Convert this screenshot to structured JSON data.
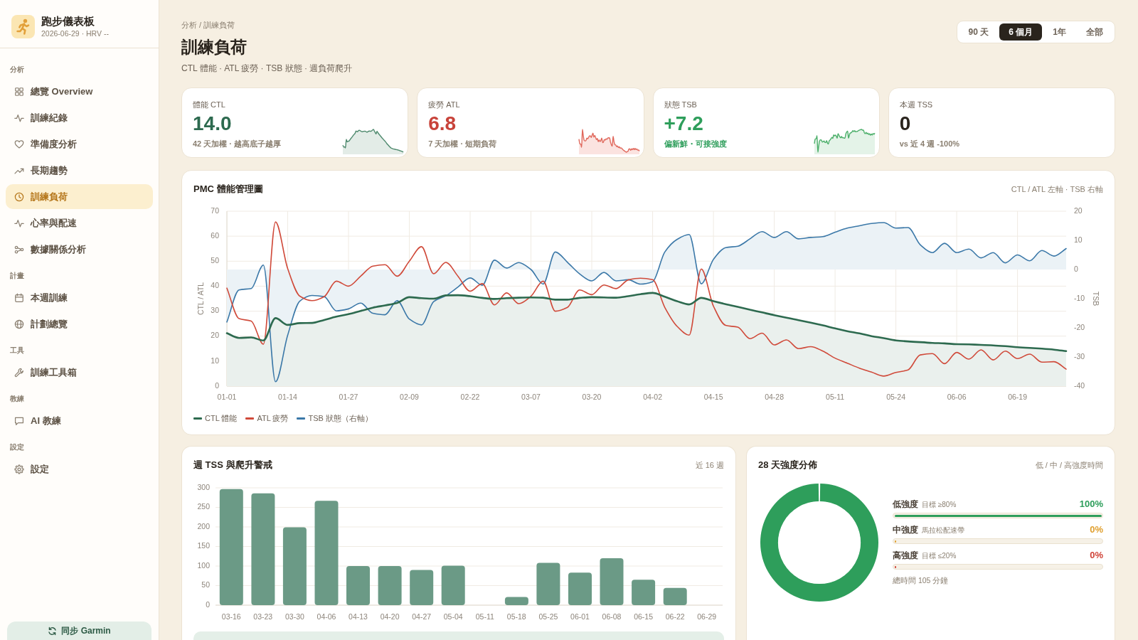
{
  "sidebar": {
    "app_title": "跑步儀表板",
    "app_subtitle": "2026-06-29 · HRV --",
    "groups": [
      {
        "label": "分析",
        "items": [
          {
            "label": "總覽 Overview",
            "selected": false
          },
          {
            "label": "訓練紀錄",
            "selected": false
          },
          {
            "label": "準備度分析",
            "selected": false
          },
          {
            "label": "長期趨勢",
            "selected": false
          },
          {
            "label": "訓練負荷",
            "selected": true
          },
          {
            "label": "心率與配速",
            "selected": false
          },
          {
            "label": "數據關係分析",
            "selected": false
          }
        ]
      },
      {
        "label": "計畫",
        "items": [
          {
            "label": "本週訓練",
            "selected": false
          },
          {
            "label": "計劃總覽",
            "selected": false
          }
        ]
      },
      {
        "label": "工具",
        "items": [
          {
            "label": "訓練工具箱",
            "selected": false
          }
        ]
      },
      {
        "label": "教練",
        "items": [
          {
            "label": "AI 教練",
            "selected": false
          }
        ]
      },
      {
        "label": "設定",
        "items": [
          {
            "label": "設定",
            "selected": false
          }
        ]
      }
    ],
    "sync_button": "同步 Garmin"
  },
  "header": {
    "breadcrumb": "分析 / 訓練負荷",
    "title": "訓練負荷",
    "subtitle": "CTL 體能 · ATL 疲勞 · TSB 狀態 · 週負荷爬升",
    "range_tabs": [
      {
        "label": "90 天",
        "selected": false
      },
      {
        "label": "6 個月",
        "selected": true
      },
      {
        "label": "1年",
        "selected": false
      },
      {
        "label": "全部",
        "selected": false
      }
    ]
  },
  "kpis": [
    {
      "kind": "ctl",
      "label": "體能 CTL",
      "value": "14.0",
      "note": "42 天加權 · 越高底子越厚",
      "color": "#2d6a4f",
      "note_emphasis": false
    },
    {
      "kind": "atl",
      "label": "疲勞 ATL",
      "value": "6.8",
      "note": "7 天加權 · 短期負荷",
      "color": "#c8433a",
      "note_emphasis": false
    },
    {
      "kind": "tsb",
      "label": "狀態 TSB",
      "value": "+7.2",
      "note": "偏新鮮・可接強度",
      "color": "#2e9e5b",
      "note_emphasis": true
    },
    {
      "kind": "plain",
      "label": "本週 TSS",
      "value": "0",
      "note": "vs 近 4 週 -100%",
      "color": "#2a241d",
      "note_emphasis": false
    }
  ],
  "pmc": {
    "title": "PMC 體能管理圖",
    "meta": "CTL / ATL 左軸 · TSB 右軸",
    "chart_data": {
      "type": "line",
      "ylabel": "CTL / ATL",
      "y2label": "TSB",
      "grid": true,
      "categories": [
        "01-01",
        null,
        null,
        null,
        null,
        "01-14",
        null,
        null,
        null,
        null,
        "01-27",
        null,
        null,
        null,
        null,
        "02-09",
        null,
        null,
        null,
        null,
        "02-22",
        null,
        null,
        null,
        null,
        "03-07",
        null,
        null,
        null,
        null,
        "03-20",
        null,
        null,
        null,
        null,
        "04-02",
        null,
        null,
        null,
        null,
        "04-15",
        null,
        null,
        null,
        null,
        "04-28",
        null,
        null,
        null,
        null,
        "05-11",
        null,
        null,
        null,
        null,
        "05-24",
        null,
        null,
        null,
        null,
        "06-06",
        null,
        null,
        null,
        null,
        "06-19",
        null,
        null,
        null,
        null
      ],
      "ylim": [
        0,
        70
      ],
      "yticks": [
        0,
        10,
        20,
        30,
        40,
        50,
        60,
        70
      ],
      "y2lim": [
        -40,
        20
      ],
      "y2ticks": [
        -40,
        -30,
        -20,
        -10,
        0,
        10,
        20
      ],
      "series": [
        {
          "name": "CTL 體能",
          "color": "#2d6a4f",
          "values": [
            21.2,
            19.3,
            19.5,
            18.3,
            27.2,
            24.5,
            25.2,
            25.3,
            26.5,
            27.8,
            28.8,
            30.1,
            31.4,
            32.3,
            33.3,
            35.6,
            35.2,
            35.0,
            36.3,
            36.4,
            36.0,
            35.3,
            34.9,
            35.2,
            35.4,
            35.5,
            35.4,
            34.6,
            34.6,
            35.3,
            35.6,
            35.5,
            35.4,
            36.0,
            36.8,
            37.3,
            35.8,
            34.0,
            32.7,
            35.3,
            34.0,
            32.8,
            31.7,
            30.6,
            29.5,
            28.4,
            27.4,
            26.4,
            25.4,
            24.3,
            23.1,
            22.0,
            21.1,
            20.0,
            19.2,
            18.3,
            17.9,
            17.6,
            17.3,
            17.1,
            16.8,
            16.7,
            16.5,
            16.3,
            16.0,
            15.6,
            15.3,
            15.0,
            14.6,
            14.0
          ]
        },
        {
          "name": "ATL 疲勞",
          "color": "#d04a3a",
          "values": [
            39.2,
            27.0,
            26.0,
            16.8,
            65.7,
            47.0,
            36.0,
            34.2,
            35.8,
            42.0,
            40.0,
            44.0,
            48.0,
            48.6,
            44.0,
            50.0,
            55.8,
            45.0,
            49.5,
            44.0,
            38.0,
            41.0,
            32.5,
            37.3,
            33.0,
            36.0,
            42.0,
            30.0,
            31.5,
            38.5,
            36.6,
            40.5,
            39.0,
            42.5,
            43.2,
            42.6,
            31.5,
            24.0,
            20.4,
            46.9,
            32.0,
            24.3,
            23.6,
            19.0,
            21.2,
            16.5,
            18.5,
            15.0,
            15.8,
            14.0,
            11.2,
            9.2,
            7.2,
            5.6,
            4.0,
            5.5,
            6.5,
            12.5,
            13.0,
            9.0,
            13.5,
            10.8,
            14.5,
            10.5,
            14.0,
            11.0,
            12.8,
            9.6,
            9.8,
            6.8
          ]
        },
        {
          "name": "TSB 狀態（右軸）",
          "color": "#3b78a8",
          "axis": "y2",
          "values": [
            -18.0,
            -7.0,
            -6.5,
            1.5,
            -38.5,
            -22.5,
            -10.8,
            -8.9,
            -9.3,
            -14.2,
            -13.5,
            -11.5,
            -15.0,
            -15.5,
            -10.7,
            -17.0,
            -19.0,
            -11.0,
            -9.0,
            -6.0,
            -2.9,
            -5.4,
            3.2,
            0.5,
            2.4,
            0.0,
            -5.0,
            6.0,
            2.5,
            -1.5,
            -3.9,
            -1.0,
            -3.9,
            -3.5,
            -5.0,
            -4.2,
            6.0,
            10.3,
            12.0,
            -4.9,
            3.5,
            7.5,
            8.0,
            10.5,
            13.0,
            11.0,
            13.0,
            10.5,
            11.0,
            11.3,
            12.8,
            14.2,
            15.0,
            15.8,
            16.1,
            14.2,
            14.4,
            8.5,
            5.8,
            9.0,
            5.8,
            7.0,
            4.0,
            5.8,
            2.3,
            5.0,
            3.0,
            6.5,
            4.6,
            7.2
          ]
        }
      ]
    }
  },
  "weekly_tss": {
    "title": "週 TSS 與爬升警戒",
    "meta": "近 16 週",
    "chart_data": {
      "type": "bar",
      "grid": true,
      "categories": [
        "03-16",
        "03-23",
        "03-30",
        "04-06",
        "04-13",
        "04-20",
        "04-27",
        "05-04",
        "05-11",
        "05-18",
        "05-25",
        "06-01",
        "06-08",
        "06-15",
        "06-22",
        "06-29"
      ],
      "values": [
        297,
        286,
        199,
        267,
        100,
        100,
        90,
        101,
        0,
        21,
        108,
        83,
        120,
        65,
        44,
        0
      ],
      "ylim": [
        0,
        300
      ],
      "yticks": [
        0,
        50,
        100,
        150,
        200,
        250,
        300
      ]
    }
  },
  "intensity": {
    "title": "28 天強度分佈",
    "meta": "低 / 中 / 高強度時間",
    "chart_data": {
      "type": "donut",
      "categories": [
        "低強度",
        "中強度",
        "高強度"
      ],
      "values": [
        100,
        0,
        0
      ]
    },
    "rows": [
      {
        "note": "目標 ≥80%",
        "value": "100%",
        "level": 1,
        "color": "#2e9e5b"
      },
      {
        "note": "馬拉松配速帶",
        "value": "0%",
        "level": 0,
        "color": "#e0a030"
      },
      {
        "note": "目標 ≤20%",
        "value": "0%",
        "level": 0,
        "color": "#d0453a"
      }
    ],
    "total": "總時間 105 分鐘"
  }
}
